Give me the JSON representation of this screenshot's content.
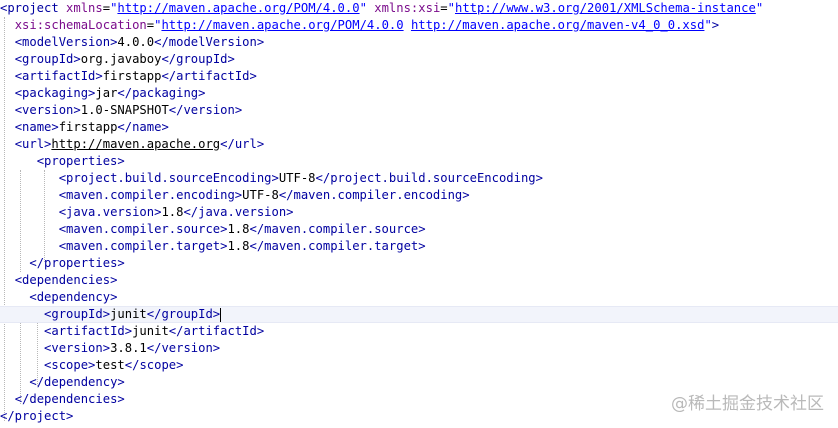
{
  "code": {
    "l1": {
      "open": "<project",
      "a1": "xmlns",
      "v1": "http://maven.apache.org/POM/4.0.0",
      "a2": "xmlns:xsi",
      "v2": "http://www.w3.org/2001/XMLSchema-instance"
    },
    "l2": {
      "a": "xsi:schemaLocation",
      "v1": "http://maven.apache.org/POM/4.0.0",
      "v2": "http://maven.apache.org/maven-v4_0_0.xsd",
      "end": ">"
    },
    "modelVersion": {
      "open": "<modelVersion>",
      "value": "4.0.0",
      "close": "</modelVersion>"
    },
    "groupId": {
      "open": "<groupId>",
      "value": "org.javaboy",
      "close": "</groupId>"
    },
    "artifactId": {
      "open": "<artifactId>",
      "value": "firstapp",
      "close": "</artifactId>"
    },
    "packaging": {
      "open": "<packaging>",
      "value": "jar",
      "close": "</packaging>"
    },
    "version": {
      "open": "<version>",
      "value": "1.0-SNAPSHOT",
      "close": "</version>"
    },
    "name": {
      "open": "<name>",
      "value": "firstapp",
      "close": "</name>"
    },
    "url": {
      "open": "<url>",
      "value": "http://maven.apache.org",
      "close": "</url>"
    },
    "properties_open": "<properties>",
    "props": [
      {
        "open": "<project.build.sourceEncoding>",
        "value": "UTF-8",
        "close": "</project.build.sourceEncoding>"
      },
      {
        "open": "<maven.compiler.encoding>",
        "value": "UTF-8",
        "close": "</maven.compiler.encoding>"
      },
      {
        "open": "<java.version>",
        "value": "1.8",
        "close": "</java.version>"
      },
      {
        "open": "<maven.compiler.source>",
        "value": "1.8",
        "close": "</maven.compiler.source>"
      },
      {
        "open": "<maven.compiler.target>",
        "value": "1.8",
        "close": "</maven.compiler.target>"
      }
    ],
    "properties_close": "</properties>",
    "dependencies_open": "<dependencies>",
    "dependency_open": "<dependency>",
    "dep": [
      {
        "open": "<groupId>",
        "value": "junit",
        "close": "</groupId>"
      },
      {
        "open": "<artifactId>",
        "value": "junit",
        "close": "</artifactId>"
      },
      {
        "open": "<version>",
        "value": "3.8.1",
        "close": "</version>"
      },
      {
        "open": "<scope>",
        "value": "test",
        "close": "</scope>"
      }
    ],
    "dependency_close": "</dependency>",
    "dependencies_close": "</dependencies>",
    "project_close": "</project>"
  },
  "watermark": {
    "text": "@稀土掘金技术社区"
  },
  "colors": {
    "tag": "#0000a0",
    "attribute": "#7b0d8c",
    "value": "#0000ff",
    "current_line": "#f2f4fb"
  }
}
